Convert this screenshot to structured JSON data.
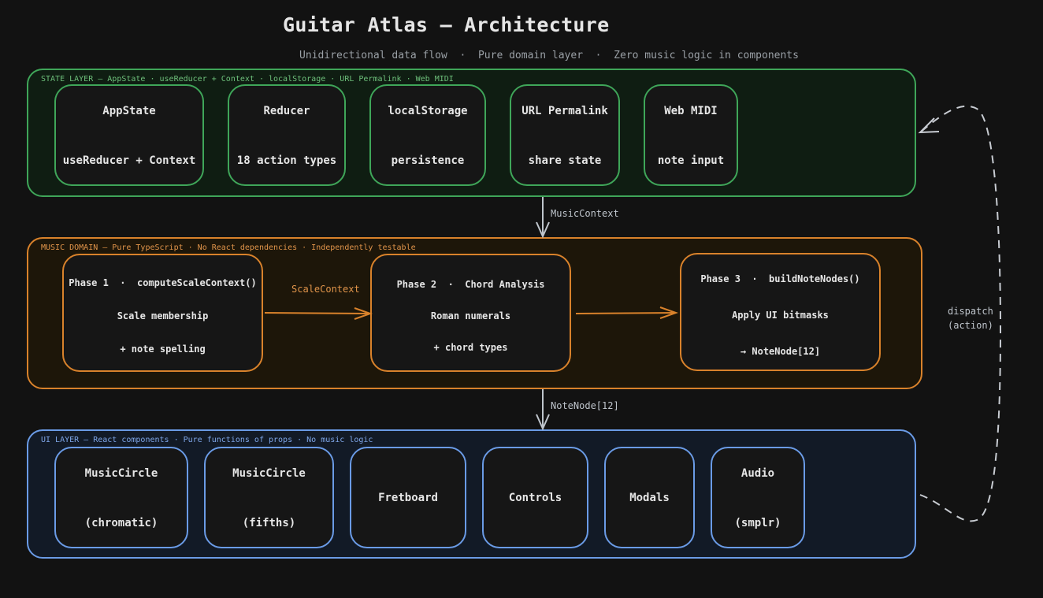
{
  "title": "Guitar Atlas — Architecture",
  "subtitle": "Unidirectional data flow  ·  Pure domain layer  ·  Zero music logic in components",
  "colors": {
    "state": "#3fa659",
    "music": "#d9822b",
    "ui": "#6a9be6",
    "arrow": "#bfc5cc"
  },
  "state_layer": {
    "label": "STATE LAYER — AppState · useReducer + Context · localStorage · URL Permalink · Web MIDI",
    "boxes": [
      {
        "title": "AppState",
        "sub": "useReducer + Context"
      },
      {
        "title": "Reducer",
        "sub": "18 action types"
      },
      {
        "title": "localStorage",
        "sub": "persistence"
      },
      {
        "title": "URL Permalink",
        "sub": "share state"
      },
      {
        "title": "Web MIDI",
        "sub": "note input"
      }
    ]
  },
  "music_layer": {
    "label": "MUSIC DOMAIN — Pure TypeScript · No React dependencies · Independently testable",
    "phases": [
      {
        "title": "Phase 1  ·  computeScaleContext()",
        "line1": "Scale membership",
        "line2": "+ note spelling"
      },
      {
        "title": "Phase 2  ·  Chord Analysis",
        "line1": "Roman numerals",
        "line2": "+ chord types"
      },
      {
        "title": "Phase 3  ·  buildNoteNodes()",
        "line1": "Apply UI bitmasks",
        "line2": "→ NoteNode[12]"
      }
    ]
  },
  "ui_layer": {
    "label": "UI LAYER — React components · Pure functions of props · No music logic",
    "boxes": [
      {
        "title": "MusicCircle",
        "sub": "(chromatic)"
      },
      {
        "title": "MusicCircle",
        "sub": "(fifths)"
      },
      {
        "title": "Fretboard",
        "sub": ""
      },
      {
        "title": "Controls",
        "sub": ""
      },
      {
        "title": "Modals",
        "sub": ""
      },
      {
        "title": "Audio",
        "sub": "(smplr)"
      }
    ]
  },
  "edges": {
    "music_context": "MusicContext",
    "scale_context": "ScaleContext",
    "note_node": "NoteNode[12]",
    "dispatch_line1": "dispatch",
    "dispatch_line2": "(action)"
  }
}
